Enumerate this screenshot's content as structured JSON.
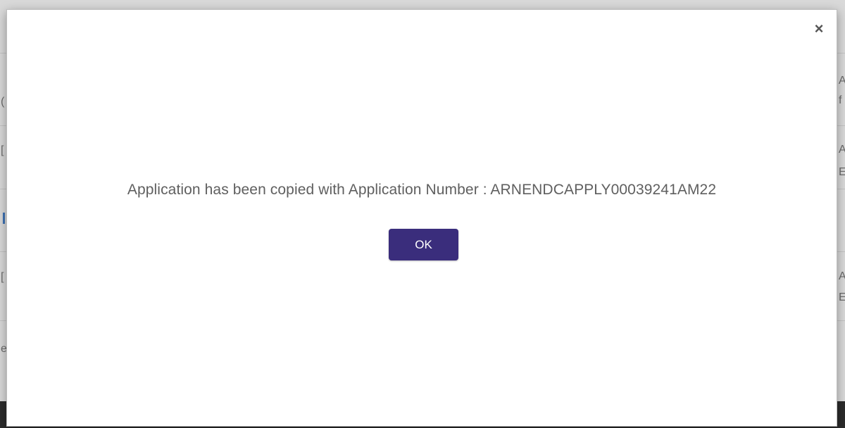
{
  "modal": {
    "close_glyph": "×",
    "message": "Application has been copied with Application Number : ARNENDCAPPLY00039241AM22",
    "ok_label": "OK"
  },
  "background": {
    "left_fragments": [
      "(",
      "[",
      "[",
      "e"
    ],
    "right_fragments": [
      "A",
      "f",
      "A",
      "E",
      "A",
      "E"
    ]
  },
  "colors": {
    "ok_button": "#3a2d7c",
    "message_text": "#5f5f5f",
    "overlay": "#7a7a7a"
  }
}
